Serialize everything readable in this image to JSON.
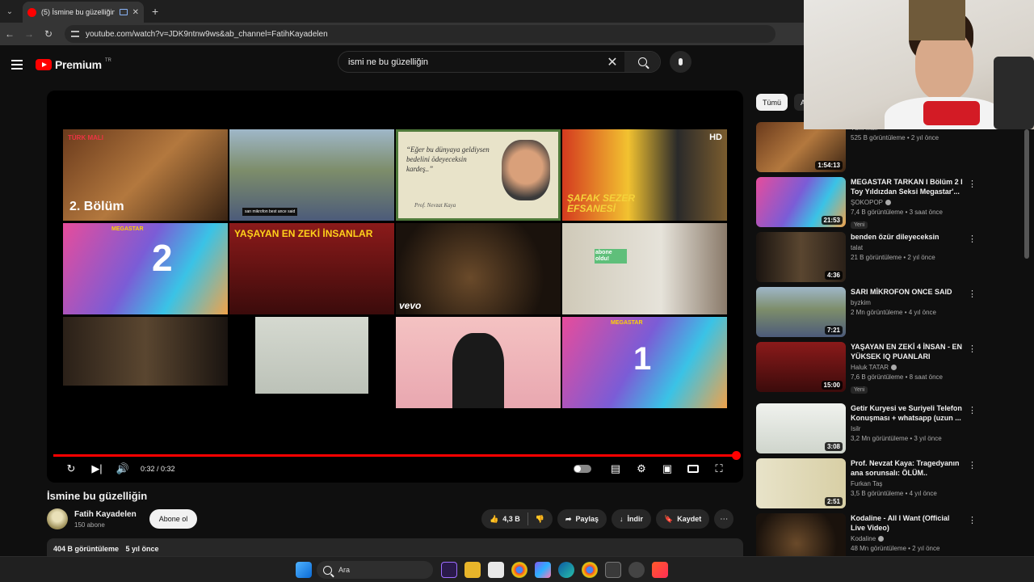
{
  "browser": {
    "tab_title": "(5) İsmine bu güzelliğin - Yo",
    "url": "youtube.com/watch?v=JDK9ntnw9ws&ab_channel=FatihKayadelen"
  },
  "header": {
    "brand": "Premium",
    "region": "TR",
    "search_query": "ismi ne bu güzelliğin"
  },
  "thumbs": [
    {
      "label": "2. Bölüm",
      "tag": "TÜRK MALI"
    },
    {
      "label": "san mikrofon best ance said"
    },
    {
      "label": "“Eğer bu dünyaya geldiysen bedelini ödeyeceksin kardeş..”",
      "sub": "Prof. Nevzat Kaya"
    },
    {
      "label": "ŞAFAK SEZER EFSANESİ",
      "tag": "HD"
    },
    {
      "label": "2",
      "tag": "MEGASTAR"
    },
    {
      "label": "YAŞAYAN EN ZEKİ İNSANLAR"
    },
    {
      "label": "vevo"
    },
    {
      "label": "abone oldu!"
    },
    {
      "label": ""
    },
    {
      "label": ""
    },
    {
      "label": ""
    },
    {
      "label": "1",
      "tag": "MEGASTAR"
    }
  ],
  "player": {
    "time": "0:32 / 0:32",
    "progress": 1.0
  },
  "video": {
    "title": "İsmine bu güzelliğin",
    "channel": "Fatih Kayadelen",
    "subscribers": "150 abone",
    "subscribe_label": "Abone ol",
    "likes": "4,3 B",
    "share_label": "Paylaş",
    "download_label": "İndir",
    "save_label": "Kaydet",
    "views": "404 B görüntüleme",
    "age": "5 yıl önce"
  },
  "sidebar": {
    "chips": [
      "Tümü",
      "A"
    ],
    "items": [
      {
        "title": "",
        "channel": "Türk Malı",
        "stats": "525 B görüntüleme • 2 yıl önce",
        "duration": "1:54:13",
        "badge": "",
        "verified": false
      },
      {
        "title": "MEGASTAR TARKAN I Bölüm 2 I Toy Yıldızdan Seksi Megastar'...",
        "channel": "ŞOKOPOP",
        "stats": "7,4 B görüntüleme • 3 saat önce",
        "duration": "21:53",
        "badge": "Yeni",
        "verified": true
      },
      {
        "title": "benden özür dileyeceksin",
        "channel": "talat",
        "stats": "21 B görüntüleme • 2 yıl önce",
        "duration": "4:36",
        "badge": "",
        "verified": false
      },
      {
        "title": "SARI MİKROFON ONCE SAID",
        "channel": "byzkim",
        "stats": "2 Mn görüntüleme • 4 yıl önce",
        "duration": "7:21",
        "badge": "",
        "verified": false
      },
      {
        "title": "YAŞAYAN EN ZEKİ 4 İNSAN - EN YÜKSEK IQ PUANLARI",
        "channel": "Haluk TATAR",
        "stats": "7,6 B görüntüleme • 8 saat önce",
        "duration": "15:00",
        "badge": "Yeni",
        "verified": true
      },
      {
        "title": "Getir Kuryesi ve Suriyeli Telefon Konuşması + whatsapp (uzun ...",
        "channel": "Isilr",
        "stats": "3,2 Mn görüntüleme • 3 yıl önce",
        "duration": "3:08",
        "badge": "",
        "verified": false
      },
      {
        "title": "Prof. Nevzat Kaya: Tragedyanın ana sorunsalı: ÖLÜM..",
        "channel": "Furkan Taş",
        "stats": "3,5 B görüntüleme • 4 yıl önce",
        "duration": "2:51",
        "badge": "",
        "verified": false
      },
      {
        "title": "Kodaline - All I Want (Official Live Video)",
        "channel": "Kodaline",
        "stats": "48 Mn görüntüleme • 2 yıl önce",
        "duration": "",
        "badge": "",
        "verified": true
      }
    ]
  },
  "taskbar": {
    "search_label": "Ara"
  },
  "colors": {
    "accent": "#ff0000",
    "background": "#0f0f0f",
    "surface": "#272727"
  }
}
